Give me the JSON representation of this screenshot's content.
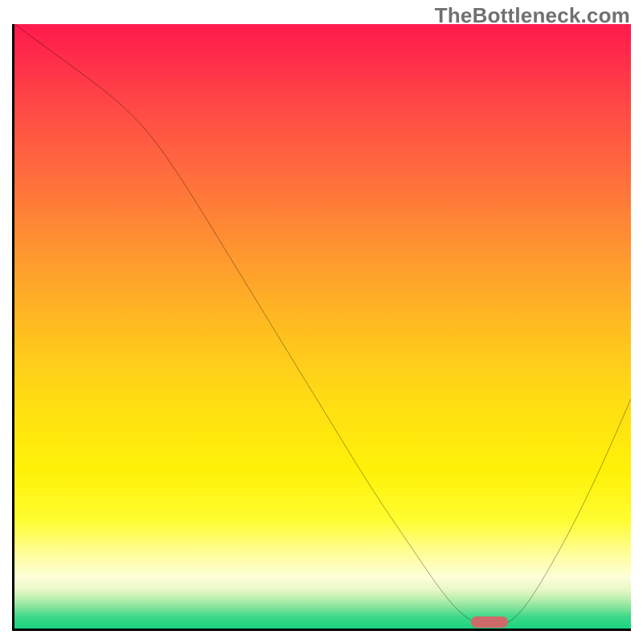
{
  "watermark": "TheBottleneck.com",
  "colors": {
    "curve": "#000000",
    "optimum_marker": "#cf6a6a",
    "axis": "#000000"
  },
  "chart_data": {
    "type": "line",
    "title": "",
    "xlabel": "",
    "ylabel": "",
    "xlim": [
      0,
      100
    ],
    "ylim": [
      0,
      100
    ],
    "x": [
      0,
      8,
      16,
      22,
      28,
      34,
      40,
      46,
      52,
      58,
      64,
      70,
      74,
      78,
      82,
      88,
      94,
      100
    ],
    "values": [
      100,
      94,
      88,
      82,
      73,
      63,
      53,
      43,
      33,
      23,
      14,
      5,
      1,
      0,
      2,
      12,
      24,
      38
    ],
    "optimum_x_range": [
      74,
      80
    ],
    "gradient_note": "vertical heat gradient (red→yellow→green) behind curve; no numeric tick labels visible"
  }
}
